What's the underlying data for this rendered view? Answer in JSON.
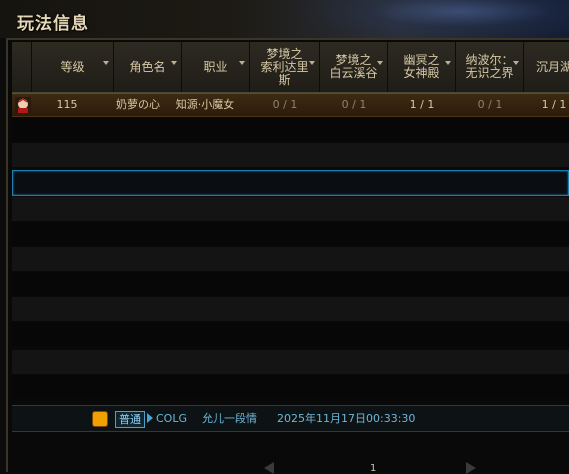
{
  "window": {
    "title": "玩法信息"
  },
  "columns": [
    {
      "label": "",
      "sortable": false
    },
    {
      "label": "等级",
      "sortable": true
    },
    {
      "label": "角色名",
      "sortable": true
    },
    {
      "label": "职业",
      "sortable": true
    },
    {
      "label": "梦境之\n索利达里\n斯",
      "sortable": true
    },
    {
      "label": "梦境之\n白云溪谷",
      "sortable": true
    },
    {
      "label": "幽冥之\n女神殿",
      "sortable": true
    },
    {
      "label": "纳波尔：\n无识之界",
      "sortable": true
    },
    {
      "label": "沉月湖",
      "sortable": false
    }
  ],
  "rows": [
    {
      "level": "115",
      "name": "奶萝の心",
      "job": "知源·小魔女",
      "cells": [
        "0 / 1",
        "0 / 1",
        "1 / 1",
        "0 / 1",
        "1 / 1"
      ]
    }
  ],
  "chat": {
    "channel": "普通",
    "guild": "COLG",
    "speaker": "允儿一段情",
    "time": "2025年11月17日00:33:30"
  },
  "pager": {
    "page": "1"
  },
  "colors": {
    "accent": "#1a7fb0",
    "gold_text": "#d8c9a5",
    "row_highlight": "#3d2a12"
  }
}
